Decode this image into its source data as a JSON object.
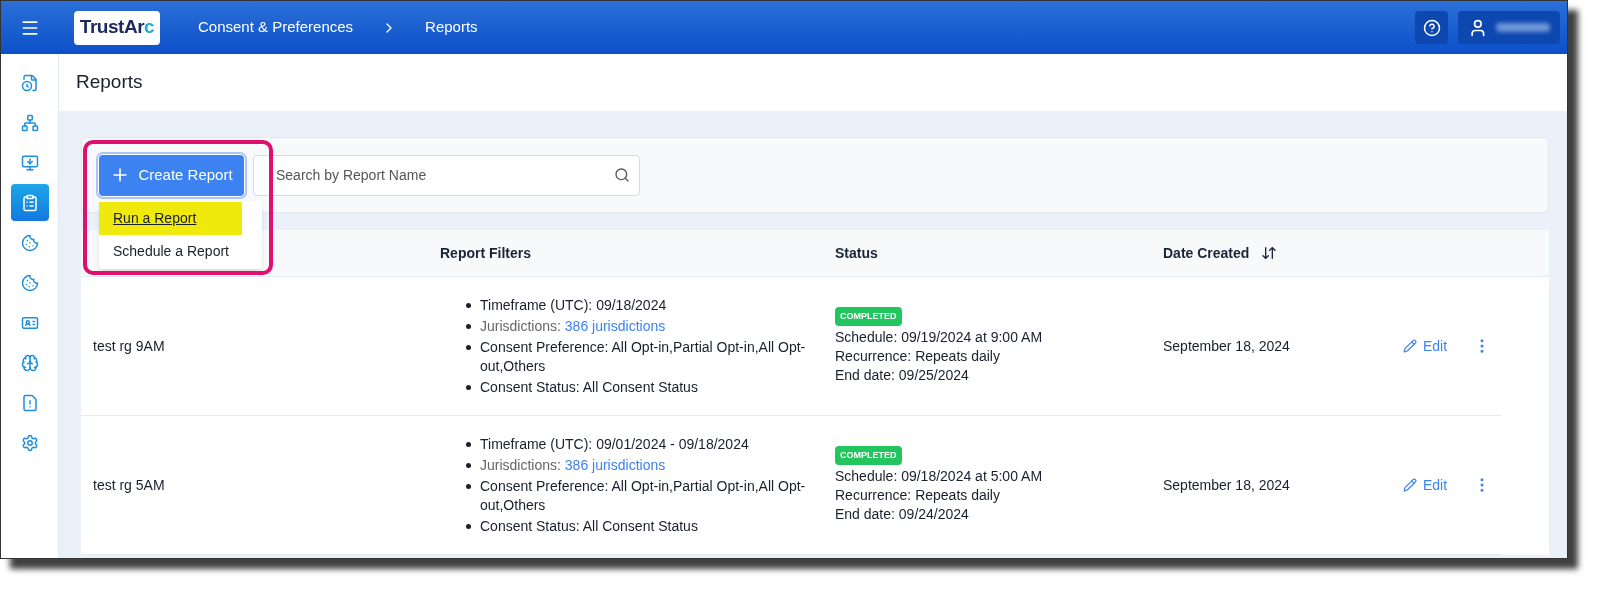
{
  "header": {
    "logo": {
      "text": "TrustAr",
      "accent": "c"
    },
    "breadcrumbs": [
      "Consent & Preferences",
      "Reports"
    ]
  },
  "sidebar": {
    "items": [
      {
        "selected": false
      },
      {
        "selected": false
      },
      {
        "selected": false
      },
      {
        "selected": true
      },
      {
        "selected": false
      },
      {
        "selected": false
      },
      {
        "selected": false
      },
      {
        "selected": false
      },
      {
        "selected": false
      },
      {
        "selected": false
      }
    ]
  },
  "page": {
    "title": "Reports"
  },
  "toolbar": {
    "create_button": "Create Report",
    "search": {
      "placeholder": "Search by Report Name"
    },
    "menu": [
      {
        "label": "Run a Report",
        "highlighted": true
      },
      {
        "label": "Schedule a Report",
        "highlighted": false
      }
    ]
  },
  "table": {
    "columns": [
      {
        "label": "Report Filters",
        "sortable": false
      },
      {
        "label": "Status",
        "sortable": false
      },
      {
        "label": "Date Created",
        "sortable": true
      }
    ],
    "rows": [
      {
        "name": "test rg 9AM",
        "filters": [
          {
            "kind": "text",
            "text": "Timeframe (UTC): 09/18/2024"
          },
          {
            "kind": "link",
            "text": "Jurisdictions:",
            "link": "386 jurisdictions"
          },
          {
            "kind": "text",
            "text": "Consent Preference: All Opt-in,Partial Opt-in,All Opt-out,Others"
          },
          {
            "kind": "text",
            "text": "Consent Status: All Consent Status"
          }
        ],
        "status": {
          "badge": "COMPLETED",
          "lines": [
            "Schedule: 09/19/2024 at 9:00 AM",
            "Recurrence: Repeats daily",
            "End date: 09/25/2024"
          ]
        },
        "date": "September 18, 2024",
        "action": "Edit"
      },
      {
        "name": "test rg 5AM",
        "filters": [
          {
            "kind": "text",
            "text": "Timeframe (UTC): 09/01/2024 - 09/18/2024"
          },
          {
            "kind": "link",
            "text": "Jurisdictions:",
            "link": "386 jurisdictions"
          },
          {
            "kind": "text",
            "text": "Consent Preference: All Opt-in,Partial Opt-in,All Opt-out,Others"
          },
          {
            "kind": "text",
            "text": "Consent Status: All Consent Status"
          }
        ],
        "status": {
          "badge": "COMPLETED",
          "lines": [
            "Schedule: 09/18/2024 at 5:00 AM",
            "Recurrence: Repeats daily",
            "End date: 09/24/2024"
          ]
        },
        "date": "September 18, 2024",
        "action": "Edit"
      }
    ]
  }
}
